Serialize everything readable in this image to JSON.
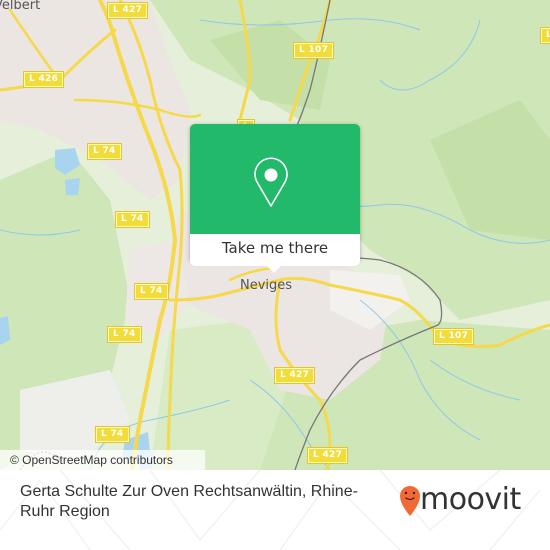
{
  "map": {
    "place_labels": [
      {
        "id": "velbert",
        "text": "Velbert"
      },
      {
        "id": "neviges",
        "text": "Neviges"
      }
    ],
    "road_labels": [
      {
        "id": "l427-top",
        "text": "L 427"
      },
      {
        "id": "l426",
        "text": "L 426"
      },
      {
        "id": "l107-top",
        "text": "L 107"
      },
      {
        "id": "l74-a",
        "text": "L 74"
      },
      {
        "id": "l74-b",
        "text": "L 74"
      },
      {
        "id": "l74-c",
        "text": "L 74"
      },
      {
        "id": "l74-d",
        "text": "L 74"
      },
      {
        "id": "l74-e",
        "text": "L 74"
      },
      {
        "id": "l107-right",
        "text": "L 107"
      },
      {
        "id": "l427-mid",
        "text": "L 427"
      },
      {
        "id": "l427-bottom",
        "text": "L 427"
      },
      {
        "id": "l-top-partial",
        "text": "L"
      },
      {
        "id": "l-right-partial",
        "text": "L"
      }
    ],
    "attribution": "© OpenStreetMap contributors",
    "colors": {
      "forest": "#c9e3b0",
      "land": "#e6efd9",
      "urban": "#ece6e4",
      "water": "#a8d4ef",
      "road": "#f5d94a",
      "rail": "#777777"
    }
  },
  "popup": {
    "icon": "location-pin-icon",
    "button_label": "Take me there",
    "color": "#22b96b"
  },
  "footer": {
    "title": "Gerta Schulte Zur Oven Rechtsanwältin, Rhine-Ruhr Region",
    "logo_text": "moovit",
    "logo_color": "#f06a35"
  }
}
